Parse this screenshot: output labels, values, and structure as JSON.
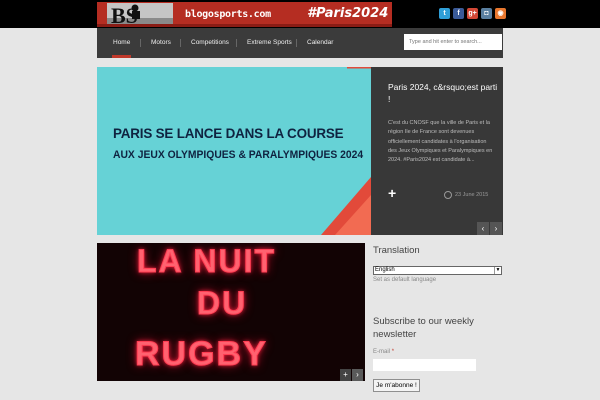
{
  "header": {
    "logo": {
      "text": "BS"
    },
    "site_name": "blogosports.com",
    "hashtag": "#Paris2024",
    "social": [
      {
        "name": "twitter",
        "glyph": "t",
        "color": "#2f9fd8"
      },
      {
        "name": "facebook",
        "glyph": "f",
        "color": "#3a5a98"
      },
      {
        "name": "google-plus",
        "glyph": "g+",
        "color": "#d34836"
      },
      {
        "name": "instagram",
        "glyph": "◘",
        "color": "#5a7fa0"
      },
      {
        "name": "rss",
        "glyph": "◉",
        "color": "#e8772e"
      }
    ]
  },
  "nav": {
    "items": [
      {
        "label": "Home",
        "active": true
      },
      {
        "label": "Motors"
      },
      {
        "label": "Competitions"
      },
      {
        "label": "Extreme Sports"
      },
      {
        "label": "Calendar"
      }
    ],
    "search_placeholder": "Type and hit enter to search..."
  },
  "slider": {
    "image_line1": "PARIS SE LANCE DANS LA COURSE",
    "image_line2": "AUX JEUX OLYMPIQUES & PARALYMPIQUES 2024",
    "title": "Paris 2024, c&rsquo;est parti !",
    "excerpt": "C'est du CNOSF que la ville de Paris et la région Ile de France sont devenues officiellement candidates à l'organisation des Jeux Olympiques et Paralympiques en 2024. #Paris2024 est candidate à...",
    "plus": "+",
    "date": "23 June 2015",
    "prev": "‹",
    "next": "›"
  },
  "feature": {
    "neon_line1": "LA NUIT",
    "neon_line2": "DU",
    "neon_line3": "RUGBY",
    "plus": "+",
    "next": "›"
  },
  "sidebar": {
    "translation_title": "Translation",
    "language_selected": "English",
    "default_link": "Set as default language",
    "newsletter_title": "Subscribe to our weekly newsletter",
    "email_label": "E-mail",
    "email_required": "*",
    "subscribe_label": "Je m'abonne !"
  }
}
